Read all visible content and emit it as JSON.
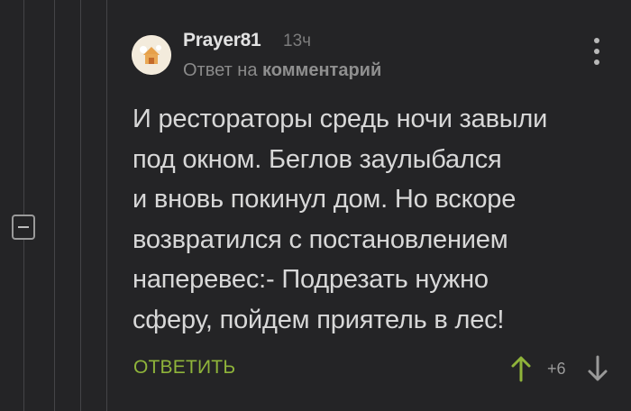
{
  "comment": {
    "author": "Prayer81",
    "time": "13ч",
    "reply_prefix": "Ответ на ",
    "reply_link": "комментарий",
    "text_lines": [
      "И рестораторы средь ночи завыли",
      "под окном. Беглов заулыбался",
      "и вновь покинул дом. Но вскоре",
      "возвратился с постановлением",
      "наперевес:- Подрезать нужно",
      "сферу, пойдем приятель в лес!"
    ],
    "reply_label": "ОТВЕТИТЬ",
    "rating": "+6"
  },
  "icons": {
    "avatar": "avatar-image",
    "menu": "more-vertical-icon",
    "collapse": "collapse-minus-icon",
    "up": "arrow-up-icon",
    "down": "arrow-down-icon"
  },
  "colors": {
    "background": "#242426",
    "accent_green": "#8fb43a",
    "text": "#d8d8d8",
    "muted": "#7c7c7c"
  }
}
